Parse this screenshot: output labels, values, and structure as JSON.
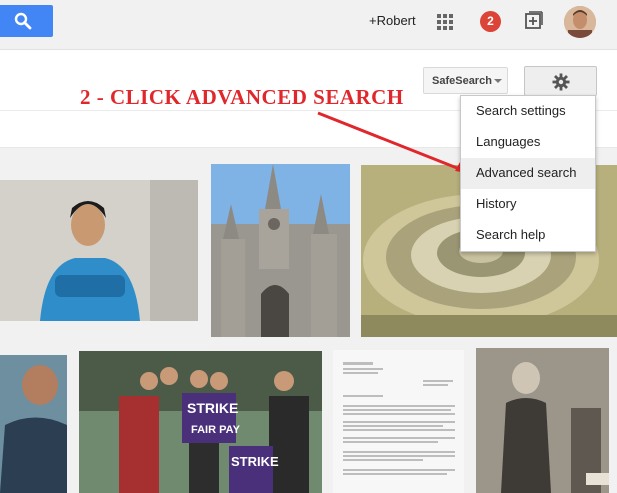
{
  "header": {
    "user_link": "+Robert",
    "notification_count": "2",
    "icons": [
      "search-icon",
      "apps-grid-icon",
      "share-plus-icon",
      "avatar"
    ]
  },
  "toolbar": {
    "safesearch_label": "SafeSearch",
    "settings_icon": "gear-icon"
  },
  "annotation": {
    "text": "2 - CLICK ADVANCED SEARCH",
    "color": "#e0272c"
  },
  "settings_menu": {
    "items": [
      {
        "label": "Search settings"
      },
      {
        "label": "Languages"
      },
      {
        "label": "Advanced search",
        "highlighted": true
      },
      {
        "label": "History"
      },
      {
        "label": "Search help"
      }
    ]
  },
  "colors": {
    "brand_blue": "#4285f4",
    "notification_red": "#db4437"
  }
}
